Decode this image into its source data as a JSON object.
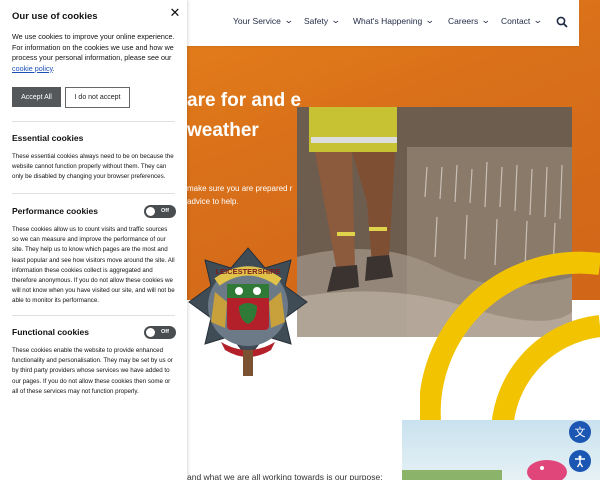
{
  "nav": {
    "items": [
      {
        "label": "Your Service"
      },
      {
        "label": "Safety"
      },
      {
        "label": "What's Happening"
      },
      {
        "label": "Careers"
      },
      {
        "label": "Contact"
      }
    ],
    "search_icon": "search-icon"
  },
  "hero": {
    "title": "are for and e weather",
    "subtitle": "make sure you are prepared r advice to help."
  },
  "crest": {
    "text": "LEICESTERSHIRE"
  },
  "bottom_text": "and what we are all working towards is our purpose:",
  "floating_buttons": [
    {
      "icon": "translate-icon"
    },
    {
      "icon": "accessibility-icon"
    }
  ],
  "cookie": {
    "title": "Our use of cookies",
    "close_icon": "close-icon",
    "intro": "We use cookies to improve your online experience. For information on the cookies we use and how we process your personal information, please see our",
    "policy_link": "cookie policy",
    "policy_suffix": ".",
    "accept_label": "Accept All",
    "decline_label": "I do not accept",
    "sections": [
      {
        "title": "Essential cookies",
        "text": "These essential cookies always need to be on because the website cannot function properly without them. They can only be disabled by changing your browser preferences."
      },
      {
        "title": "Performance cookies",
        "toggle": "Off",
        "text": "These cookies allow us to count visits and traffic sources so we can measure and improve the performance of our site. They help us to know which pages are the most and least popular and see how visitors move around the site. All information these cookies collect is aggregated and therefore anonymous. If you do not allow these cookies we will not know when you have visited our site, and will not be able to monitor its performance."
      },
      {
        "title": "Functional cookies",
        "toggle": "Off",
        "text": "These cookies enable the website to provide enhanced functionality and personalisation. They may be set by us or by third party providers whose services we have added to our pages. If you do not allow these cookies then some or all of these services may not function properly."
      }
    ]
  },
  "colors": {
    "hero_orange": "#e07a1a",
    "swirl_yellow": "#f2c300",
    "button_dark": "#55585a",
    "link_blue": "#1a4fb8",
    "float_blue": "#1c56b3"
  }
}
